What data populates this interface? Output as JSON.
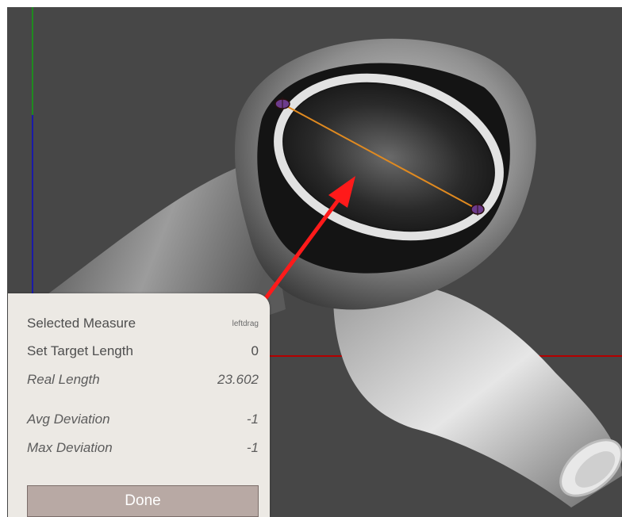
{
  "panel": {
    "selected_measure_label": "Selected Measure",
    "selected_measure_value": "leftdrag",
    "set_target_length_label": "Set Target Length",
    "set_target_length_value": "0",
    "real_length_label": "Real Length",
    "real_length_value": "23.602",
    "avg_deviation_label": "Avg Deviation",
    "avg_deviation_value": "-1",
    "max_deviation_label": "Max Deviation",
    "max_deviation_value": "-1",
    "done_label": "Done"
  },
  "viewport": {
    "background_color": "#474747",
    "axis_colors": {
      "x": "#b40000",
      "y": "#1f8a1f",
      "z": "#1a1aa8"
    },
    "measure_line_color": "#e08a20",
    "annotation_arrow_color": "#ff1a1a",
    "mesh_shape": "hollow tube with oval opening"
  }
}
